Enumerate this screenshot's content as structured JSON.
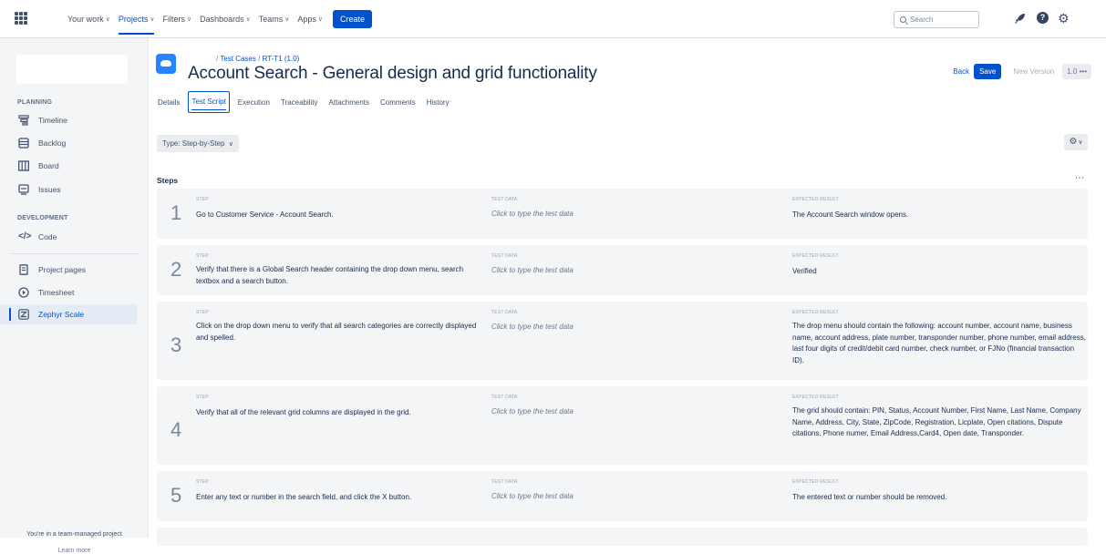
{
  "nav": {
    "items": [
      "Your work",
      "Projects",
      "Filters",
      "Dashboards",
      "Teams",
      "Apps"
    ],
    "create": "Create",
    "search_placeholder": "Search"
  },
  "sidebar": {
    "planning_title": "PLANNING",
    "planning_items": [
      "Timeline",
      "Backlog",
      "Board",
      "Issues"
    ],
    "development_title": "DEVELOPMENT",
    "development_items": [
      "Code"
    ],
    "other_items": [
      "Project pages",
      "Timesheet",
      "Zephyr Scale"
    ],
    "footer_text": "You're in a team-managed project",
    "footer_link": "Learn more"
  },
  "header": {
    "breadcrumb_1": "Test Cases",
    "breadcrumb_2": "RT-T1 (1.0)",
    "title": "Account Search - General design and grid functionality",
    "back": "Back",
    "save": "Save",
    "new_version": "New Version",
    "version": "1.0 •••"
  },
  "tabs": [
    "Details",
    "Test Script",
    "Execution",
    "Traceability",
    "Attachments",
    "Comments",
    "History"
  ],
  "type_button": "Type: Step-by-Step",
  "steps_title": "Steps",
  "labels": {
    "step": "STEP",
    "test_data": "TEST DATA",
    "expected": "EXPECTED RESULT"
  },
  "steps": [
    {
      "num": "1",
      "step": "Go to Customer Service - Account Search.",
      "test_data": "Click to type the test data",
      "expected": "The Account Search window opens."
    },
    {
      "num": "2",
      "step": "Verify that there is a Global Search header containing the drop down menu, search textbox and a search button.",
      "test_data": "Click to type the test data",
      "expected": "Verified"
    },
    {
      "num": "3",
      "step": "Click on the drop down menu to verify that all search categories are correctly displayed and spelled.",
      "test_data": "Click to type the test data",
      "expected": "The drop menu should contain the following: account number, account name, business name, account address, plate number, transponder number, phone number, email address, last four digits of credit/debit card number, check number, or FJNo (financial transaction ID)."
    },
    {
      "num": "4",
      "step": "Verify that all of the relevant grid columns are displayed in the grid.",
      "test_data": "Click to type the test data",
      "expected": "The grid should contain: PIN, Status, Account Number, First Name, Last Name, Company Name, Address, City, State, ZipCode, Registration, Licplate, Open citations, Dispute citations, Phone numer, Email Address,Card4, Open date, Transponder."
    },
    {
      "num": "5",
      "step": "Enter any text or number in the search field, and click the X button.",
      "test_data": "Click to type the test data",
      "expected": "The entered text or number should be removed."
    }
  ]
}
